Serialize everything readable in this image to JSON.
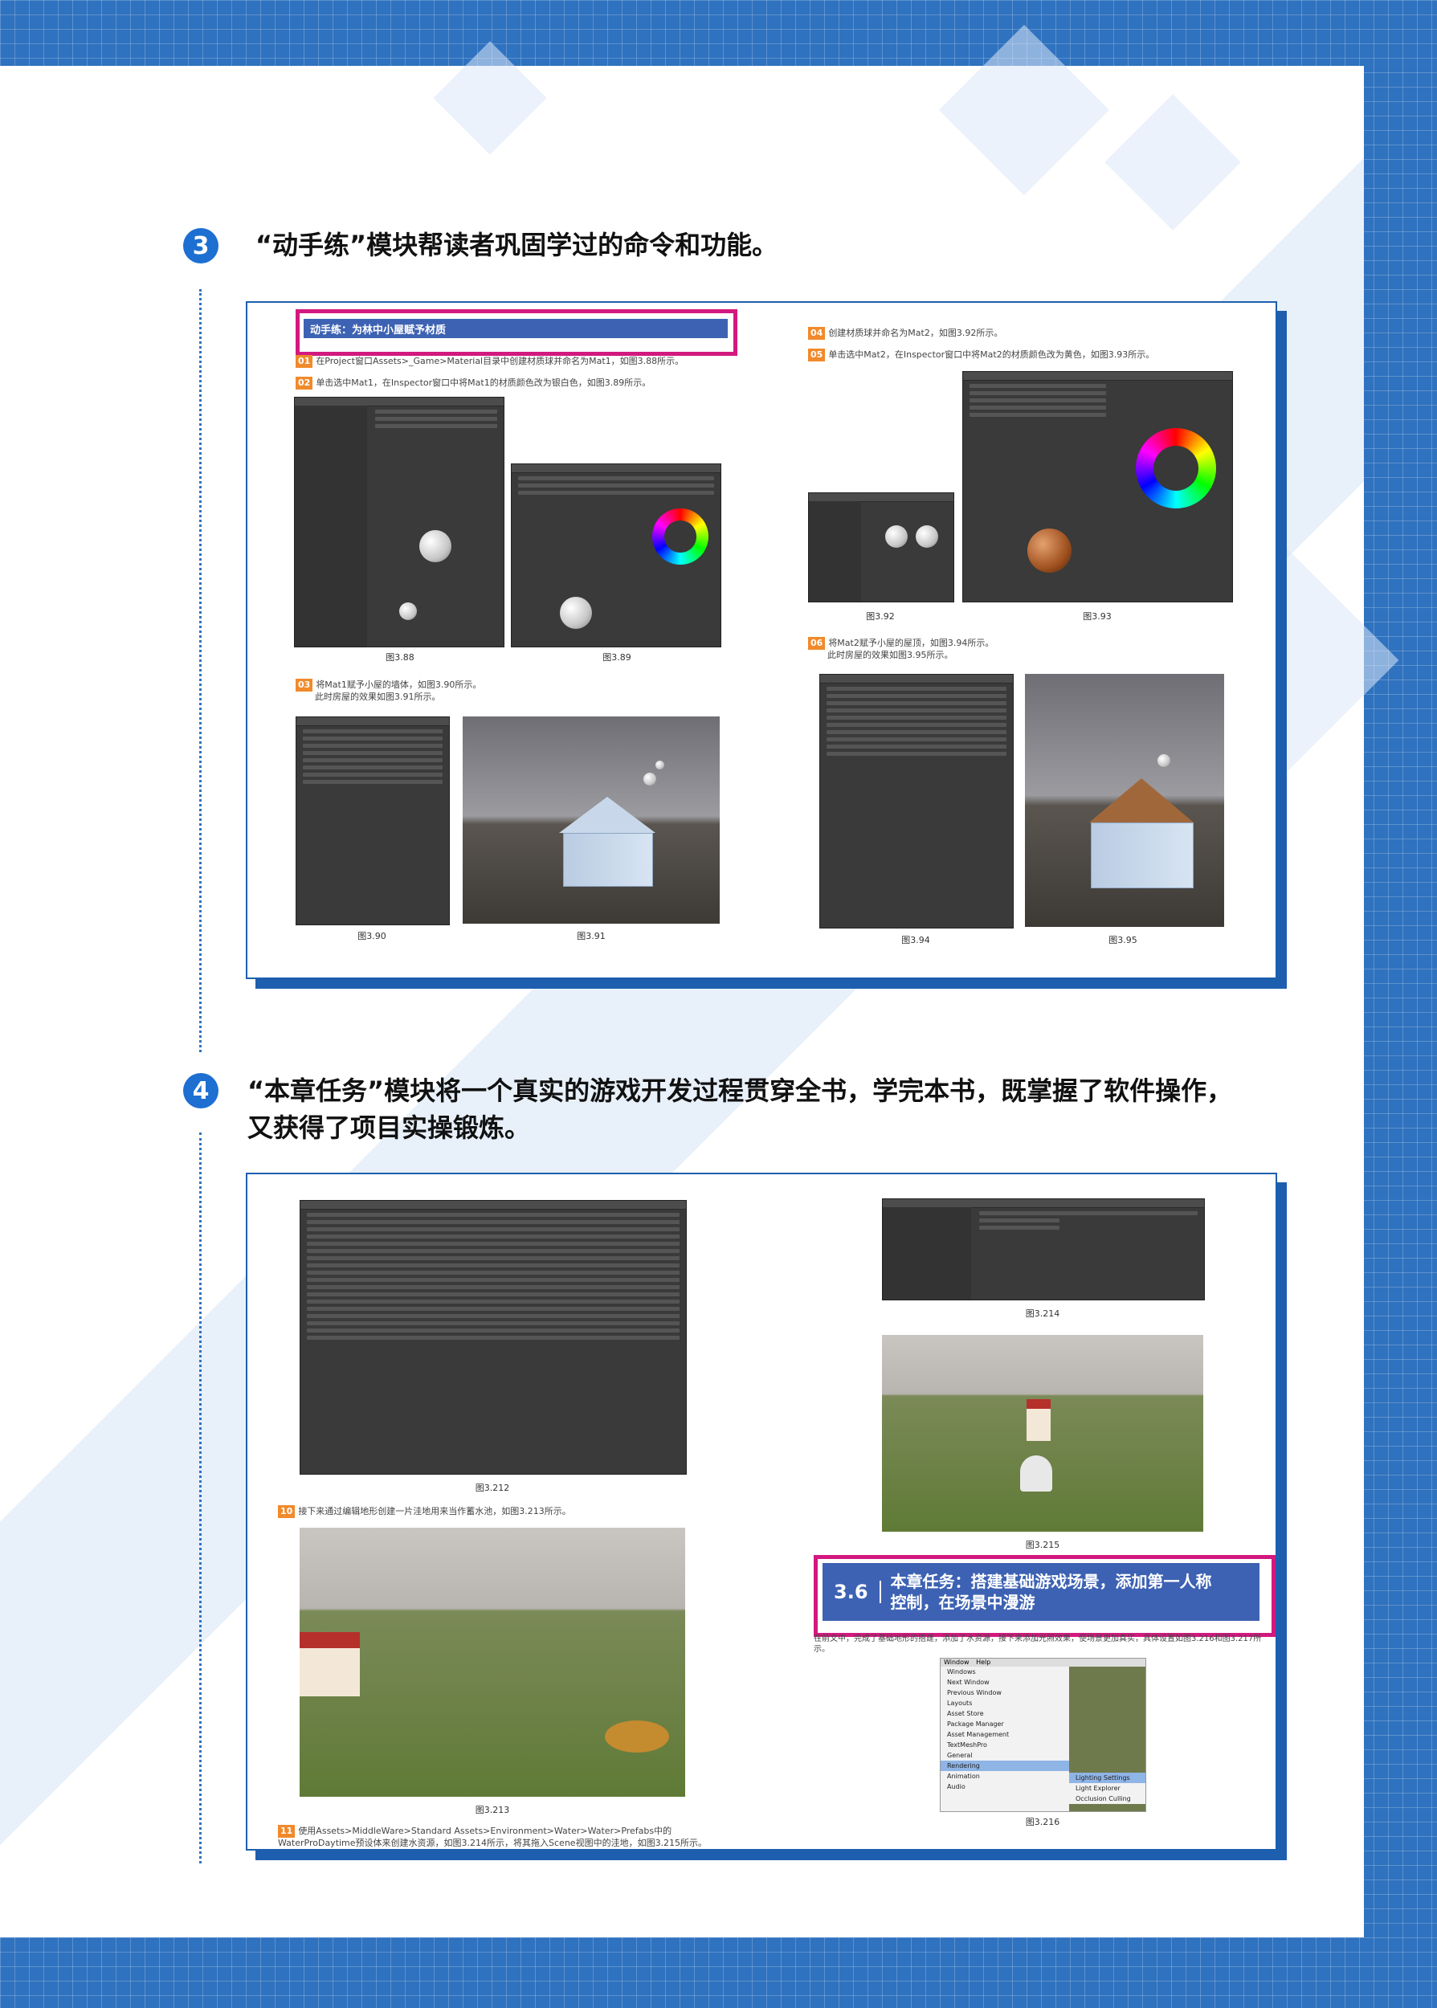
{
  "section3": {
    "number": "3",
    "heading": "“动手练”模块帮读者巩固学过的命令和功能。",
    "banner": "动手练：为林中小屋赋予材质",
    "steps": [
      {
        "tag": "01",
        "text": "在Project窗口Assets>_Game>Material目录中创建材质球并命名为Mat1，如图3.88所示。"
      },
      {
        "tag": "02",
        "text": "单击选中Mat1，在Inspector窗口中将Mat1的材质颜色改为银白色，如图3.89所示。"
      },
      {
        "tag": "03",
        "text": "将Mat1赋予小屋的墙体，如图3.90所示。",
        "text2": "此时房屋的效果如图3.91所示。"
      },
      {
        "tag": "04",
        "text": "创建材质球并命名为Mat2，如图3.92所示。"
      },
      {
        "tag": "05",
        "text": "单击选中Mat2，在Inspector窗口中将Mat2的材质颜色改为黄色，如图3.93所示。"
      },
      {
        "tag": "06",
        "text": "将Mat2赋予小屋的屋顶，如图3.94所示。",
        "text2": "此时房屋的效果如图3.95所示。"
      }
    ],
    "captions": [
      "图3.88",
      "图3.89",
      "图3.90",
      "图3.91",
      "图3.92",
      "图3.93",
      "图3.94",
      "图3.95"
    ]
  },
  "section4": {
    "number": "4",
    "heading_line1": "“本章任务”模块将一个真实的游戏开发过程贯穿全书，学完本书，既掌握了软件操作，",
    "heading_line2": "又获得了项目实操锻炼。",
    "steps": [
      {
        "tag": "10",
        "text": "接下来通过编辑地形创建一片洼地用来当作蓄水池，如图3.213所示。"
      },
      {
        "tag": "11",
        "text": "使用Assets>MiddleWare>Standard Assets>Environment>Water>Water>Prefabs中的",
        "text2": "WaterProDaytime预设体来创建水资源，如图3.214所示，将其拖入Scene视图中的洼地，如图3.215所示。"
      }
    ],
    "task_number": "3.6",
    "task_title_line1": "本章任务：搭建基础游戏场景，添加第一人称",
    "task_title_line2": "控制，在场景中漫游",
    "task_desc": "在前文中，完成了基础地形的搭建，添加了水资源，接下来添加光照效果，使场景更加真实，具体设置如图3.216和图3.217所示。",
    "captions": [
      "图3.212",
      "图3.213",
      "图3.214",
      "图3.215",
      "图3.216"
    ],
    "menu": {
      "header": [
        "Window",
        "Help"
      ],
      "items": [
        "Windows",
        "Next Window",
        "Previous Window",
        "Layouts",
        "Asset Store",
        "Package Manager",
        "Asset Management",
        "TextMeshPro",
        "General",
        "Rendering",
        "Animation",
        "Audio"
      ],
      "submenu": [
        "Lighting Settings",
        "Light Explorer",
        "Occlusion Culling"
      ]
    }
  }
}
